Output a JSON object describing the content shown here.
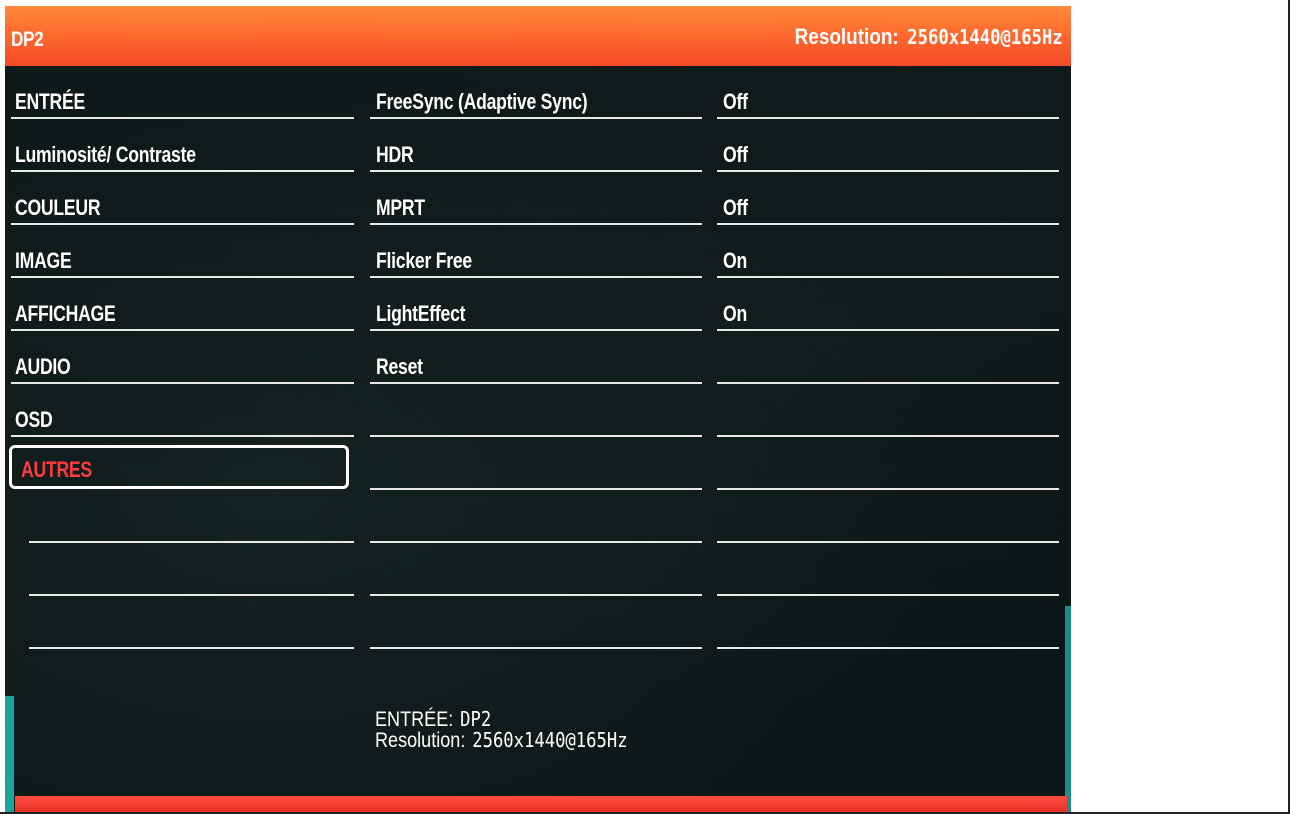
{
  "header": {
    "input": "DP2",
    "resolution_label": "Resolution:",
    "resolution_value": "2560x1440@165Hz"
  },
  "menu": {
    "items": [
      {
        "label": "ENTRÉE"
      },
      {
        "label": "Luminosité/ Contraste"
      },
      {
        "label": "COULEUR"
      },
      {
        "label": "IMAGE"
      },
      {
        "label": "AFFICHAGE"
      },
      {
        "label": "AUDIO"
      },
      {
        "label": "OSD"
      },
      {
        "label": "AUTRES",
        "selected": true
      }
    ]
  },
  "settings": {
    "items": [
      {
        "label": "FreeSync (Adaptive Sync)",
        "value": "Off"
      },
      {
        "label": "HDR",
        "value": "Off"
      },
      {
        "label": "MPRT",
        "value": "Off"
      },
      {
        "label": "Flicker Free",
        "value": "On"
      },
      {
        "label": "LightEffect",
        "value": "On"
      },
      {
        "label": "Reset",
        "value": ""
      }
    ]
  },
  "footer_info": {
    "input_label": "ENTRÉE:",
    "input_value": "DP2",
    "resolution_label": "Resolution:",
    "resolution_value": "2560x1440@165Hz"
  },
  "colors": {
    "header_top": "#ff8a3d",
    "header_bottom": "#f24a2a",
    "selected_text": "#ff3b3b",
    "accent_bar": "#e8302a",
    "background": "#0d1717"
  }
}
